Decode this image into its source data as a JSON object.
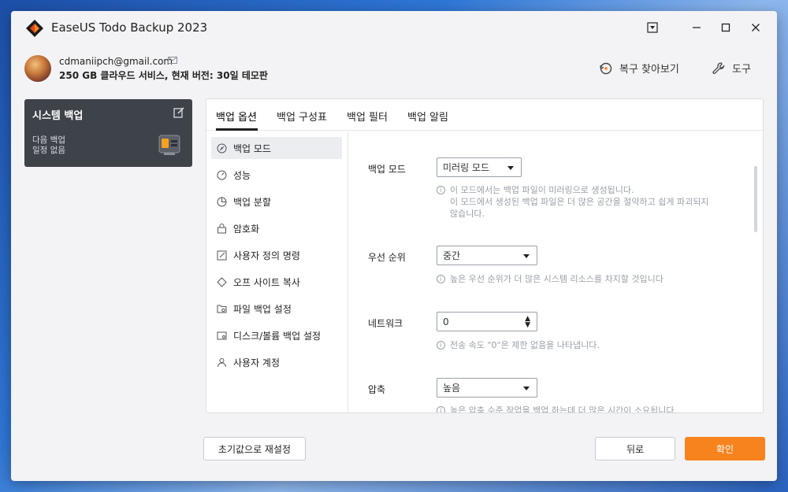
{
  "app": {
    "title": "EaseUS Todo Backup 2023"
  },
  "account": {
    "email": "cdmaniipch@gmail.com",
    "plan": "250 GB 클라우드 서비스, 현재 버전: 30일 테모판"
  },
  "header_links": {
    "restore": "복구 찾아보기",
    "tools": "도구"
  },
  "task": {
    "title": "시스템 백업",
    "next_backup": "다음 백업",
    "schedule": "일정 없음"
  },
  "tabs": [
    {
      "label": "백업 옵션"
    },
    {
      "label": "백업 구성표"
    },
    {
      "label": "백업 필터"
    },
    {
      "label": "백업 알림"
    }
  ],
  "nav": [
    {
      "label": "백업 모드",
      "icon": "backup-mode-icon"
    },
    {
      "label": "성능",
      "icon": "performance-icon"
    },
    {
      "label": "백업 분할",
      "icon": "split-icon"
    },
    {
      "label": "암호화",
      "icon": "lock-icon"
    },
    {
      "label": "사용자 정의 명령",
      "icon": "command-icon"
    },
    {
      "label": "오프 사이트 복사",
      "icon": "offsite-icon"
    },
    {
      "label": "파일 백업 설정",
      "icon": "file-backup-icon"
    },
    {
      "label": "디스크/볼륨 백업 설정",
      "icon": "disk-backup-icon"
    },
    {
      "label": "사용자 계정",
      "icon": "user-icon"
    }
  ],
  "settings": {
    "backup_mode": {
      "label": "백업 모드",
      "value": "미러링 모드",
      "hint_line1": "이 모드에서는 백업 파일이 미러링으로 생성됩니다.",
      "hint_line2": "이 모드에서 생성된 백업 파일은 더 많은 공간을 절약하고 쉽게 파괴되지",
      "hint_line3": "않습니다."
    },
    "priority": {
      "label": "우선 순위",
      "value": "중간",
      "hint": "높은 우선 순위가 더 많은 시스템 리소스를 차지할 것입니다"
    },
    "network": {
      "label": "네트워크",
      "value": "0",
      "hint": "전송 속도 \"0\"은 제한 없음을 나타냅니다."
    },
    "compression": {
      "label": "압축",
      "value": "높음",
      "hint": "높은 압축 수준 작업을 백업 하는데 더 많은 시간이 소요됩니다."
    }
  },
  "footer": {
    "reset": "초기값으로 재설정",
    "back": "뒤로",
    "confirm": "확인"
  },
  "colors": {
    "accent": "#f7831f",
    "card": "#3e4249"
  }
}
